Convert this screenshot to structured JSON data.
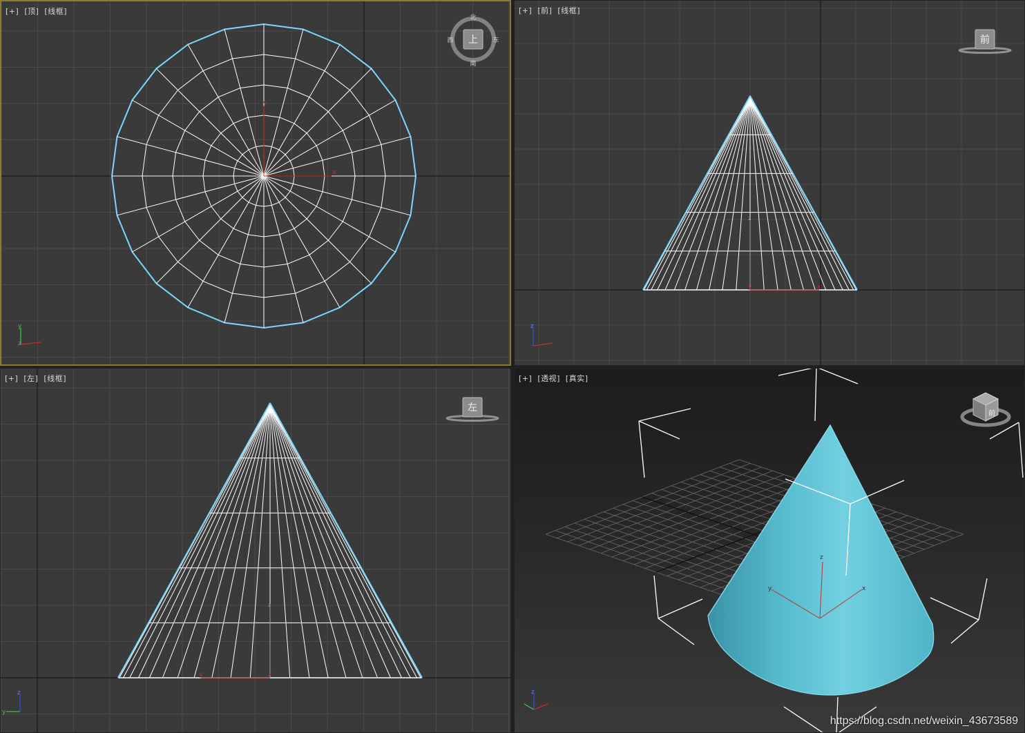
{
  "viewports": {
    "top": {
      "menu": "[+]",
      "view": "[顶]",
      "shading": "[线框]"
    },
    "front": {
      "menu": "[+]",
      "view": "[前]",
      "shading": "[线框]"
    },
    "left": {
      "menu": "[+]",
      "view": "[左]",
      "shading": "[线框]"
    },
    "persp": {
      "menu": "[+]",
      "view": "[透视]",
      "shading": "[真实]"
    }
  },
  "viewcube": {
    "top": {
      "face": "上",
      "north": "北",
      "south": "南",
      "east": "东",
      "west": "西"
    },
    "front": {
      "face": "前"
    },
    "left": {
      "face": "左"
    },
    "persp": {
      "face": "前"
    }
  },
  "axes": {
    "x": "x",
    "y": "y",
    "z": "z"
  },
  "watermark": "https://blog.csdn.net/weixin_43673589",
  "colors": {
    "active_border": "#8e7a30",
    "viewport_bg": "#3a3a3a",
    "grid": "#4b4b4b",
    "wire": "#ffffff",
    "selection_edge": "#7ad8ff",
    "cone_shaded": "#5ec3d6",
    "axis_x": "#c23030",
    "axis_y": "#40c040",
    "axis_z": "#3050e0"
  }
}
